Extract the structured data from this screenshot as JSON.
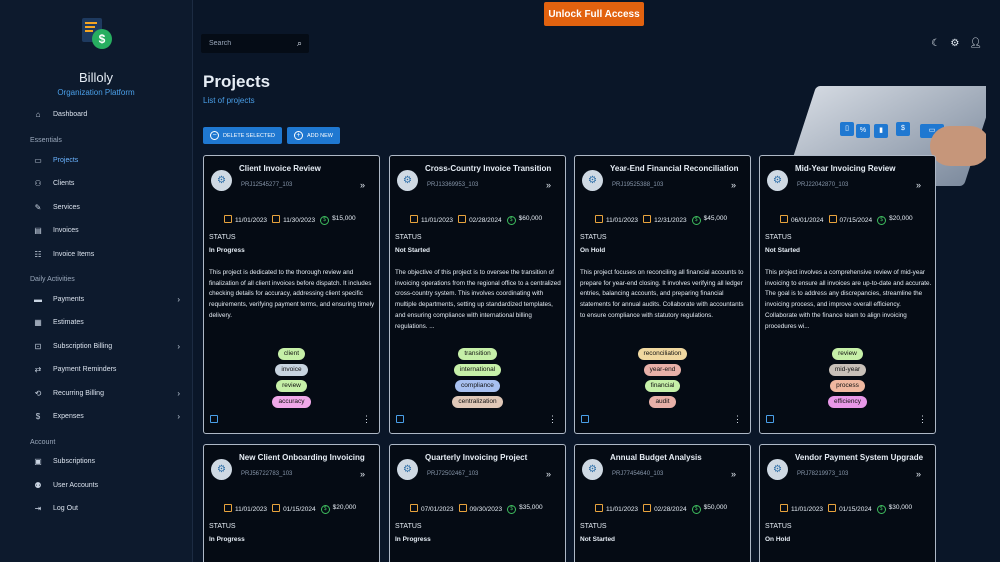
{
  "sidebar": {
    "app_name": "Billoly",
    "app_sub": "Organization Platform",
    "dashboard": "Dashboard",
    "sections": [
      "Essentials",
      "Daily Activities",
      "Account"
    ],
    "essentials": [
      "Projects",
      "Clients",
      "Services",
      "Invoices",
      "Invoice Items"
    ],
    "daily": [
      "Payments",
      "Estimates",
      "Subscription Billing",
      "Payment Reminders",
      "Recurring Billing",
      "Expenses"
    ],
    "account": [
      "Subscriptions",
      "User Accounts",
      "Log Out"
    ]
  },
  "topbar": {
    "search_placeholder": "Search",
    "unlock_label": "Unlock Full Access"
  },
  "page": {
    "title": "Projects",
    "subtitle": "List of projects",
    "delete_label": "DELETE SELECTED",
    "add_label": "ADD NEW",
    "status_label": "STATUS"
  },
  "projects": [
    {
      "title": "Client Invoice Review",
      "id": "PRJ12545277_103",
      "start": "11/01/2023",
      "end": "11/30/2023",
      "amount": "$15,000",
      "status": "In Progress",
      "description": "This project is dedicated to the thorough review and finalization of all client invoices before dispatch. It includes checking details for accuracy, addressing client specific requirements, verifying payment terms, and ensuring timely delivery.",
      "tags": [
        {
          "label": "client",
          "color": "#c6f0a8"
        },
        {
          "label": "invoice",
          "color": "#c8d4e0"
        },
        {
          "label": "review",
          "color": "#c6f0a8"
        },
        {
          "label": "accuracy",
          "color": "#f0a8e8"
        }
      ]
    },
    {
      "title": "Cross-Country Invoice Transition",
      "id": "PRJ13369953_103",
      "start": "11/01/2023",
      "end": "02/28/2024",
      "amount": "$60,000",
      "status": "Not Started",
      "description": "The objective of this project is to oversee the transition of invoicing operations from the regional office to a centralized cross-country system. This involves coordinating with multiple departments, setting up standardized templates, and ensuring compliance with international billing regulations. ...",
      "tags": [
        {
          "label": "transition",
          "color": "#c6f0a8"
        },
        {
          "label": "international",
          "color": "#c6f0a8"
        },
        {
          "label": "compliance",
          "color": "#a8c0f0"
        },
        {
          "label": "centralization",
          "color": "#e0c8b8"
        }
      ]
    },
    {
      "title": "Year-End Financial Reconciliation",
      "id": "PRJ19525388_103",
      "start": "11/01/2023",
      "end": "12/31/2023",
      "amount": "$45,000",
      "status": "On Hold",
      "description": "This project focuses on reconciling all financial accounts to prepare for year-end closing. It involves verifying all ledger entries, balancing accounts, and preparing financial statements for annual audits. Collaborate with accountants to ensure compliance with statutory regulations.",
      "tags": [
        {
          "label": "reconciliation",
          "color": "#f0d8a0"
        },
        {
          "label": "year-end",
          "color": "#e8b0a8"
        },
        {
          "label": "financial",
          "color": "#c6f0a8"
        },
        {
          "label": "audit",
          "color": "#e8b0a8"
        }
      ]
    },
    {
      "title": "Mid-Year Invoicing Review",
      "id": "PRJ22042870_103",
      "start": "06/01/2024",
      "end": "07/15/2024",
      "amount": "$20,000",
      "status": "Not Started",
      "description": "This project involves a comprehensive review of mid-year invoicing to ensure all invoices are up-to-date and accurate. The goal is to address any discrepancies, streamline the invoicing process, and improve overall efficiency. Collaborate with the finance team to align invoicing procedures wi...",
      "tags": [
        {
          "label": "review",
          "color": "#c6f0a8"
        },
        {
          "label": "mid-year",
          "color": "#c8c0b8"
        },
        {
          "label": "process",
          "color": "#f0b8a0"
        },
        {
          "label": "efficiency",
          "color": "#e898e8"
        }
      ]
    },
    {
      "title": "New Client Onboarding Invoicing",
      "id": "PRJ56722783_103",
      "start": "11/01/2023",
      "end": "01/15/2024",
      "amount": "$20,000",
      "status": "In Progress",
      "description": "",
      "tags": []
    },
    {
      "title": "Quarterly Invoicing Project",
      "id": "PRJ72502467_103",
      "start": "07/01/2023",
      "end": "09/30/2023",
      "amount": "$35,000",
      "status": "In Progress",
      "description": "",
      "tags": []
    },
    {
      "title": "Annual Budget Analysis",
      "id": "PRJ77454640_103",
      "start": "11/01/2023",
      "end": "02/28/2024",
      "amount": "$50,000",
      "status": "Not Started",
      "description": "",
      "tags": []
    },
    {
      "title": "Vendor Payment System Upgrade",
      "id": "PRJ78219973_103",
      "start": "11/01/2023",
      "end": "01/15/2024",
      "amount": "$30,000",
      "status": "On Hold",
      "description": "",
      "tags": []
    }
  ]
}
